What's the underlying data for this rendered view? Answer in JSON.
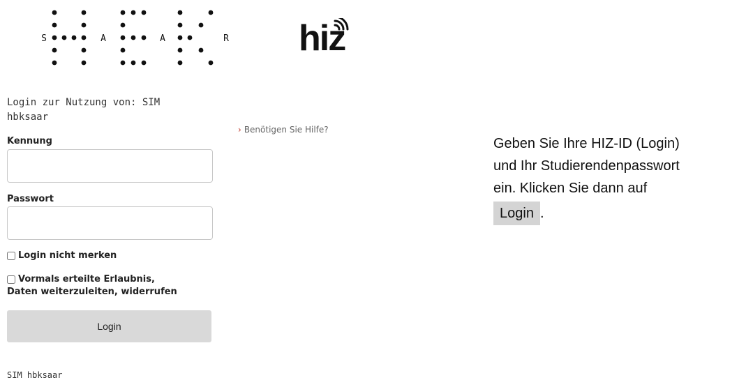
{
  "logos": {
    "hbk_letters": [
      "S",
      "A",
      "A",
      "R"
    ],
    "hiz_text": "hiz"
  },
  "login": {
    "service_title": "Login zur Nutzung von: SIM hbksaar",
    "username_label": "Kennung",
    "username_value": "",
    "password_label": "Passwort",
    "password_value": "",
    "remember_label": "Login nicht merken",
    "revoke_label_line1": "Vormals erteilte Erlaubnis,",
    "revoke_label_line2": "Daten weiterzuleiten, widerrufen",
    "login_button": "Login"
  },
  "help": {
    "chevron": "›",
    "text": "Benötigen Sie Hilfe?"
  },
  "footer": {
    "text": "SIM hbksaar"
  },
  "instructions": {
    "line1": "Geben Sie Ihre HIZ-ID (Login)",
    "line2": "und Ihr Studierendenpasswort",
    "line3": "ein. Klicken Sie dann auf",
    "button_label": "Login",
    "trailing": "."
  },
  "colors": {
    "button_bg": "#d9d9d9",
    "help_chevron": "#c0392b",
    "input_border": "#c8c8c8"
  }
}
